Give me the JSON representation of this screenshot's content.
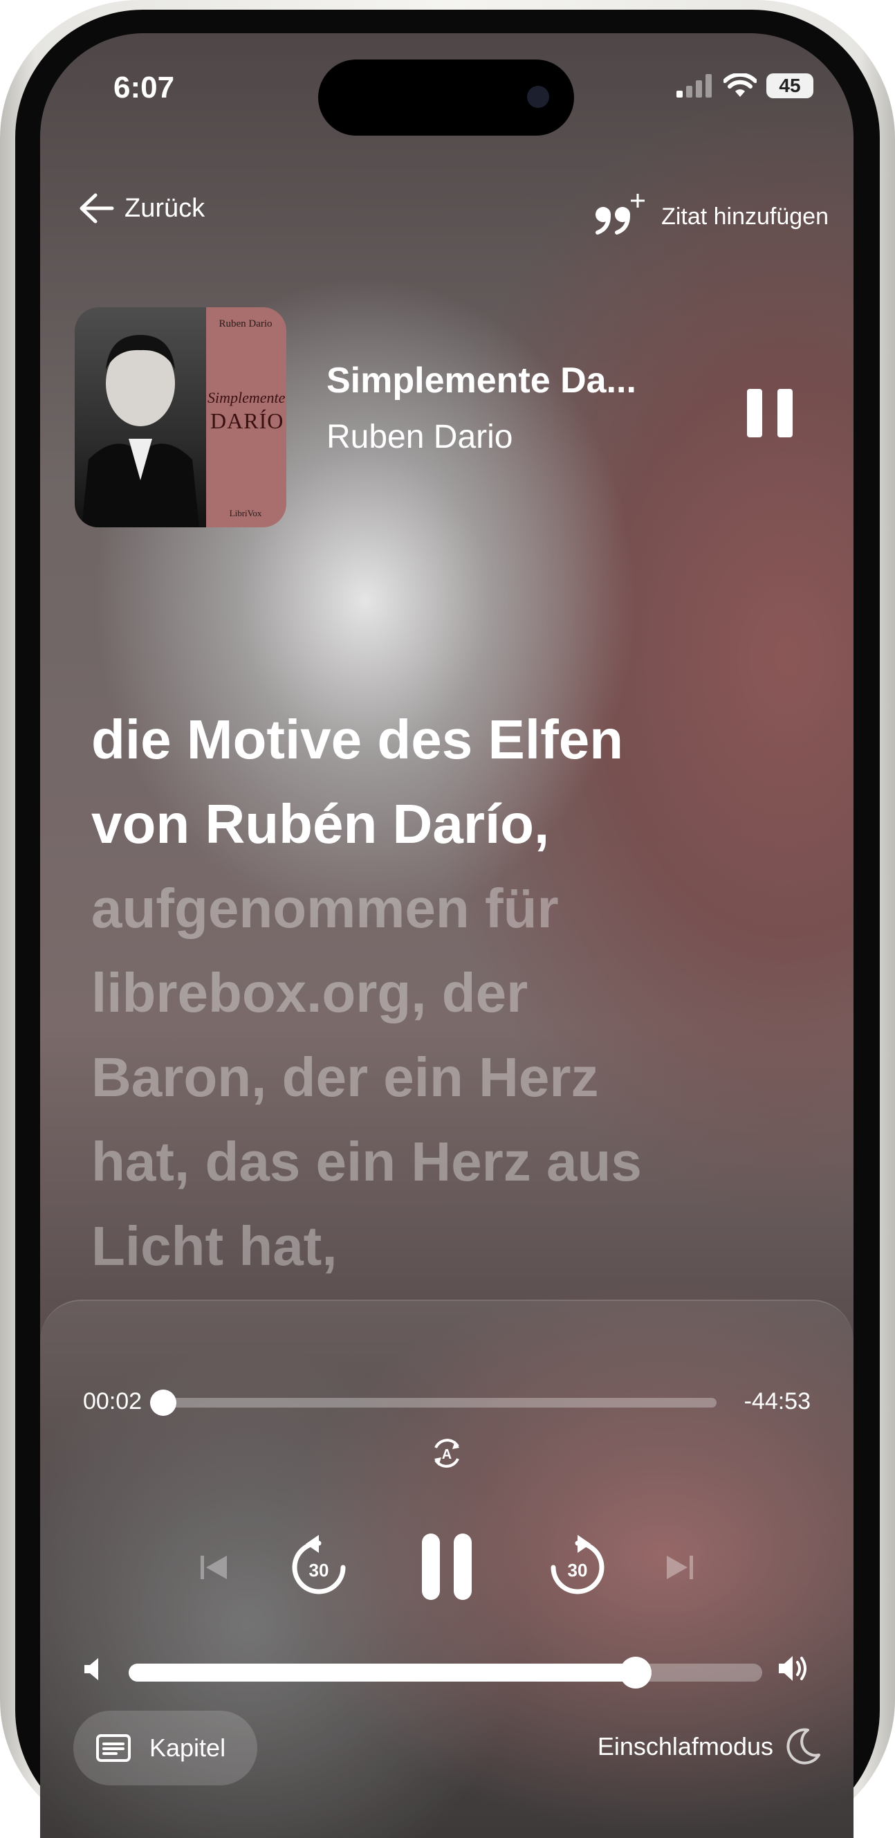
{
  "status_bar": {
    "time": "6:07",
    "battery": "45"
  },
  "header": {
    "back_label": "Zurück",
    "quote_label": "Zitat hinzufügen"
  },
  "cover": {
    "author": "Ruben Dario",
    "title_line1": "Simplemente",
    "title_line2": "DARÍO",
    "publisher": "LibriVox"
  },
  "now_playing": {
    "title": "Simplemente  Da...",
    "author": "Ruben Dario"
  },
  "lyrics": {
    "active": [
      "die Motive des Elfen",
      "von Rubén Darío,"
    ],
    "upcoming": [
      "aufgenommen für",
      "librebox.org, der",
      "Baron, der ein Herz",
      "hat, das ein Herz aus",
      "Licht hat,"
    ]
  },
  "playback": {
    "elapsed": "00:02",
    "remaining": "-44:53",
    "progress_fraction": 0.0,
    "skip_back_seconds": "30",
    "skip_forward_seconds": "30",
    "volume_fraction": 0.8
  },
  "footer": {
    "chapters_label": "Kapitel",
    "sleep_label": "Einschlafmodus"
  },
  "colors": {
    "text": "#ffffff",
    "dim_text": "rgba(255,255,255,0.35)",
    "accent_bg": "#6f6666"
  },
  "icons": [
    "back-arrow-icon",
    "quote-plus-icon",
    "pause-icon",
    "autoplay-icon",
    "previous-track-icon",
    "replay-30-icon",
    "forward-30-icon",
    "next-track-icon",
    "volume-low-icon",
    "volume-high-icon",
    "chapters-icon",
    "moon-icon",
    "signal-icon",
    "wifi-icon"
  ]
}
